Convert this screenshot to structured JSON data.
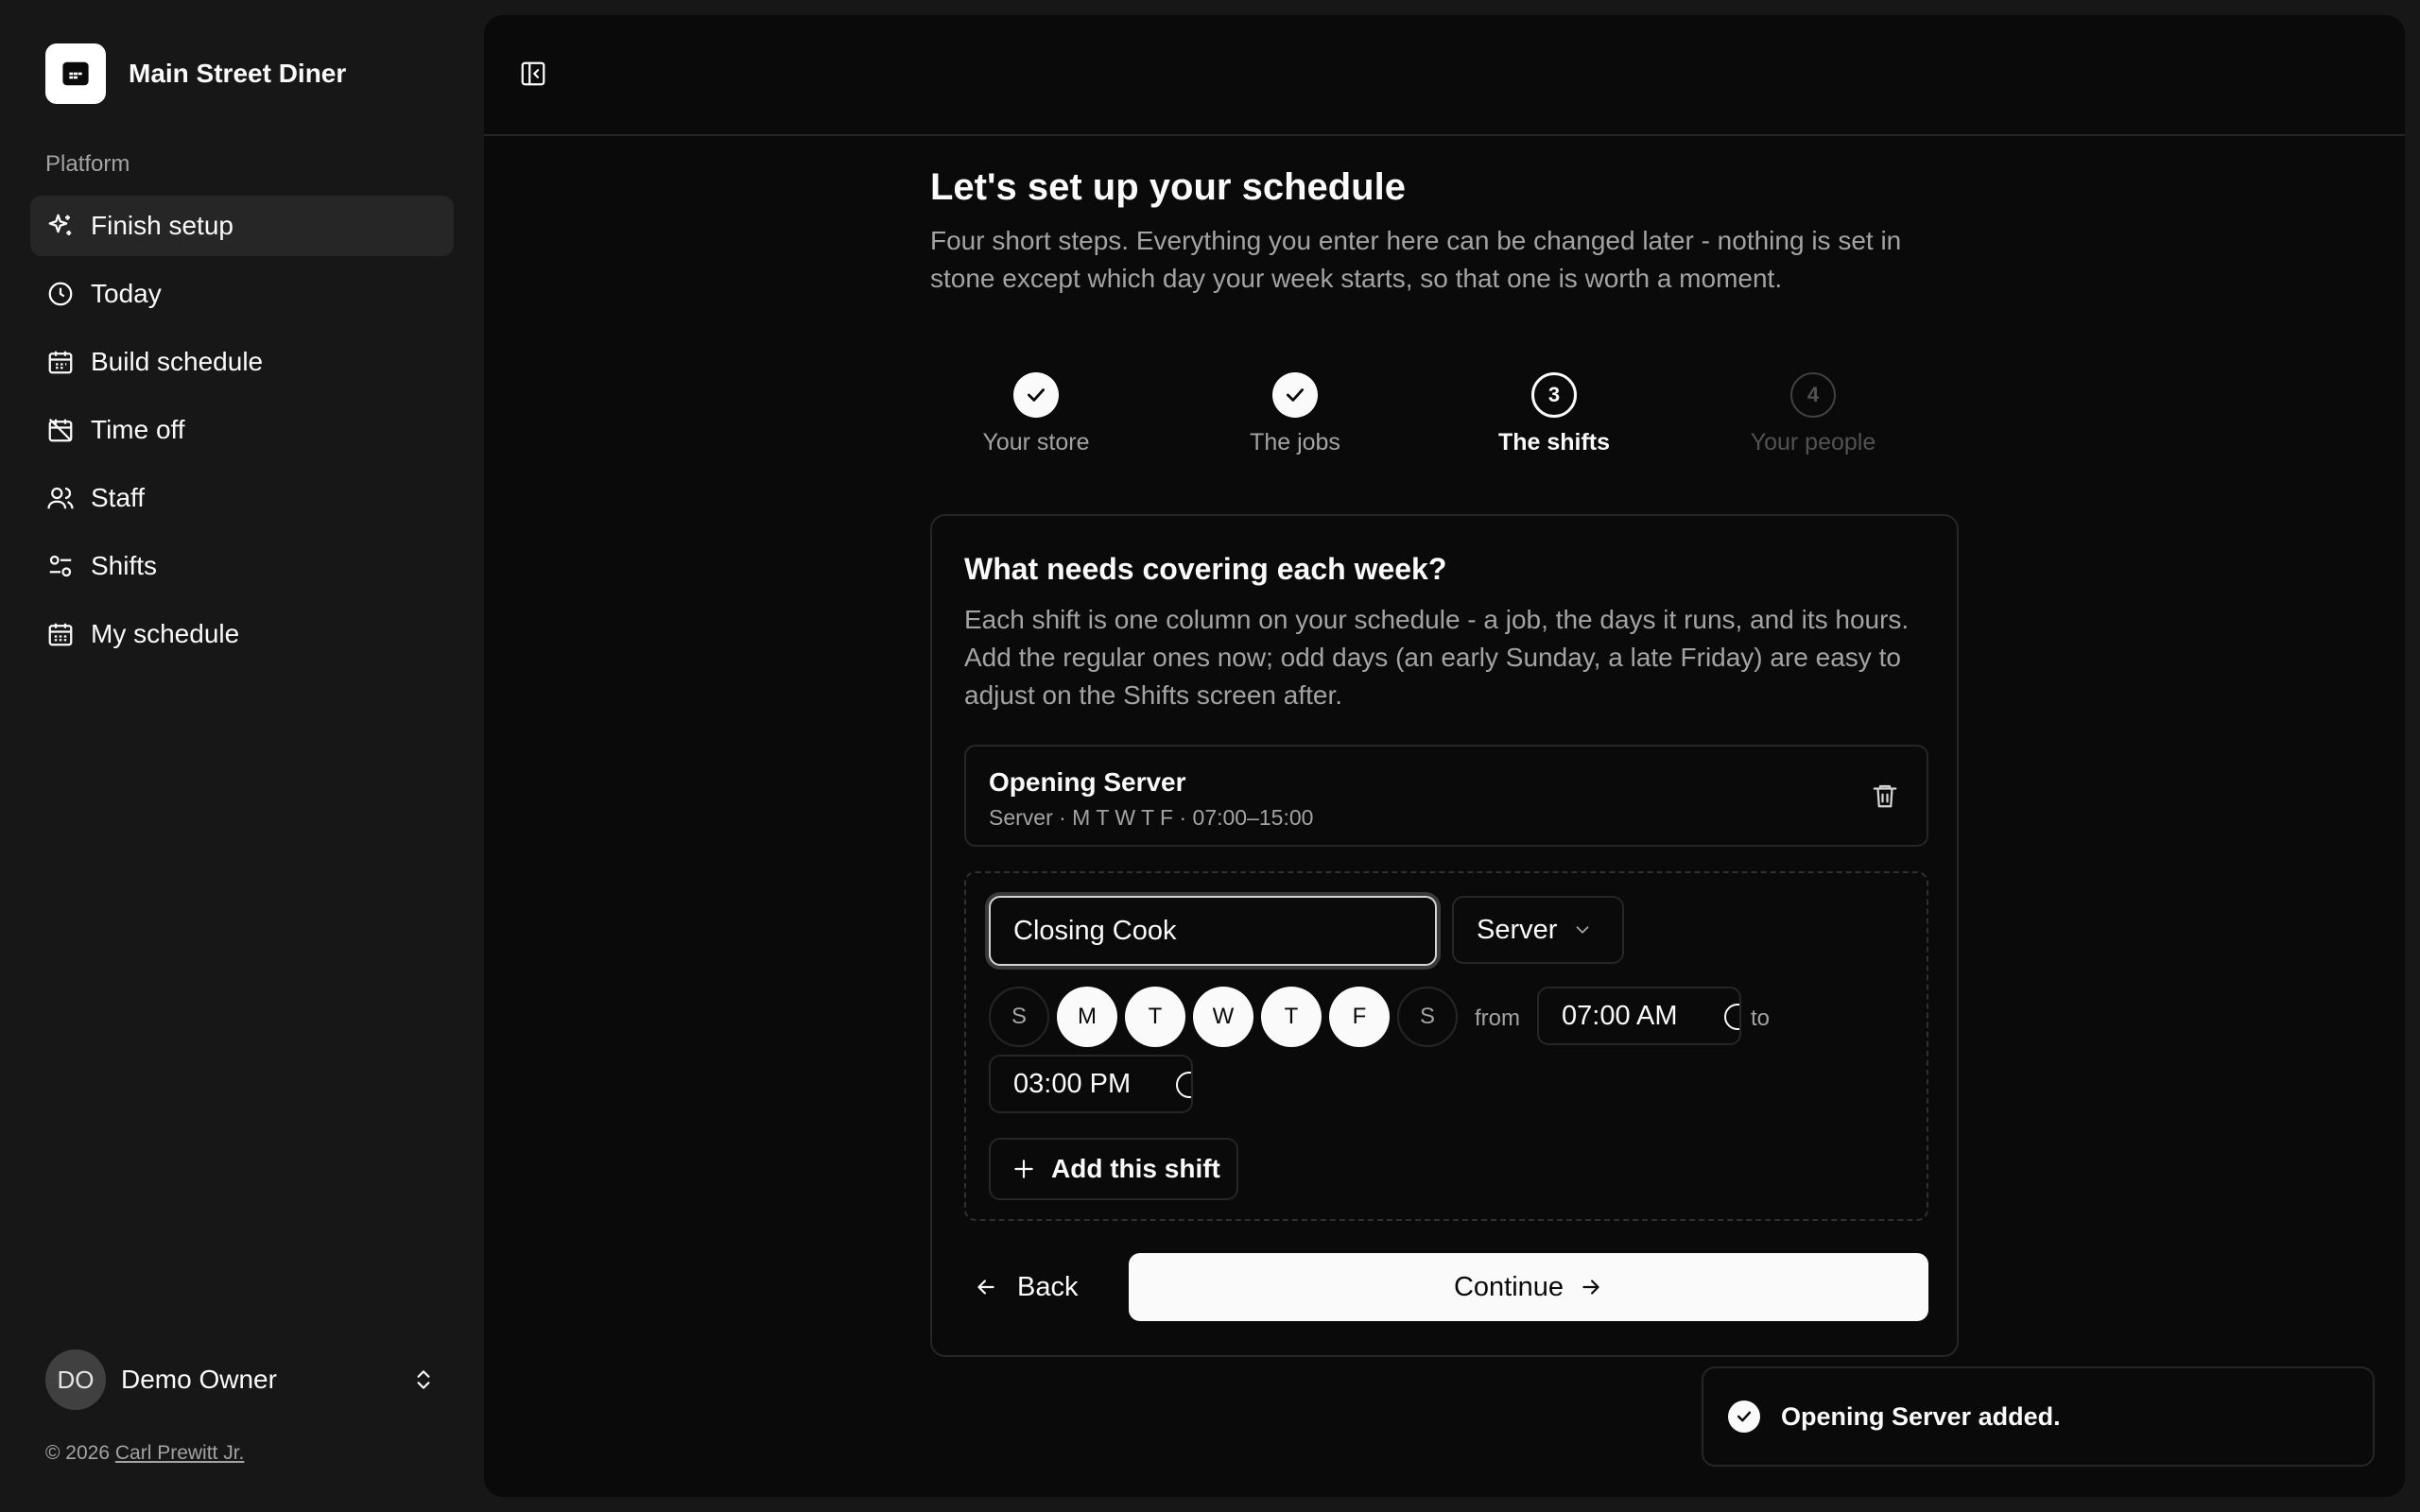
{
  "app": {
    "name": "Main Street Diner",
    "logo_icon": "store-grid-icon"
  },
  "sidebar": {
    "group_label": "Platform",
    "items": [
      {
        "label": "Finish setup",
        "icon": "sparkles-icon",
        "active": true
      },
      {
        "label": "Today",
        "icon": "clock-icon"
      },
      {
        "label": "Build schedule",
        "icon": "calendar-grid-icon"
      },
      {
        "label": "Time off",
        "icon": "calendar-off-icon"
      },
      {
        "label": "Staff",
        "icon": "users-icon"
      },
      {
        "label": "Shifts",
        "icon": "sliders-icon"
      },
      {
        "label": "My schedule",
        "icon": "calendar-days-icon"
      }
    ],
    "user": {
      "initials": "DO",
      "name": "Demo Owner"
    },
    "footer": {
      "prefix": "© 2026 ",
      "link": "Carl Prewitt Jr."
    }
  },
  "page": {
    "title": "Let's set up your schedule",
    "intro": "Four short steps. Everything you enter here can be changed later - nothing is set in stone except which day your week starts, so that one is worth a moment."
  },
  "stepper": {
    "steps": [
      {
        "label": "Your store",
        "state": "done",
        "number": "1"
      },
      {
        "label": "The jobs",
        "state": "done",
        "number": "2"
      },
      {
        "label": "The shifts",
        "state": "current",
        "number": "3"
      },
      {
        "label": "Your people",
        "state": "future",
        "number": "4"
      }
    ]
  },
  "card": {
    "title": "What needs covering each week?",
    "description": "Each shift is one column on your schedule - a job, the days it runs, and its hours. Add the regular ones now; odd days (an early Sunday, a late Friday) are easy to adjust on the Shifts screen after.",
    "existing_shift": {
      "name": "Opening Server",
      "meta": "Server · M T W T F · 07:00–15:00"
    },
    "new_shift": {
      "name_value": "Closing Cook",
      "role": "Server",
      "days": [
        {
          "label": "S",
          "selected": false
        },
        {
          "label": "M",
          "selected": true
        },
        {
          "label": "T",
          "selected": true
        },
        {
          "label": "W",
          "selected": true
        },
        {
          "label": "T",
          "selected": true
        },
        {
          "label": "F",
          "selected": true
        },
        {
          "label": "S",
          "selected": false
        }
      ],
      "from_label": "from",
      "from_time": "07:00 AM",
      "to_label": "to",
      "to_time": "03:00 PM",
      "add_label": "Add this shift"
    },
    "back_label": "Back",
    "continue_label": "Continue"
  },
  "toast": {
    "message": "Opening Server added."
  }
}
